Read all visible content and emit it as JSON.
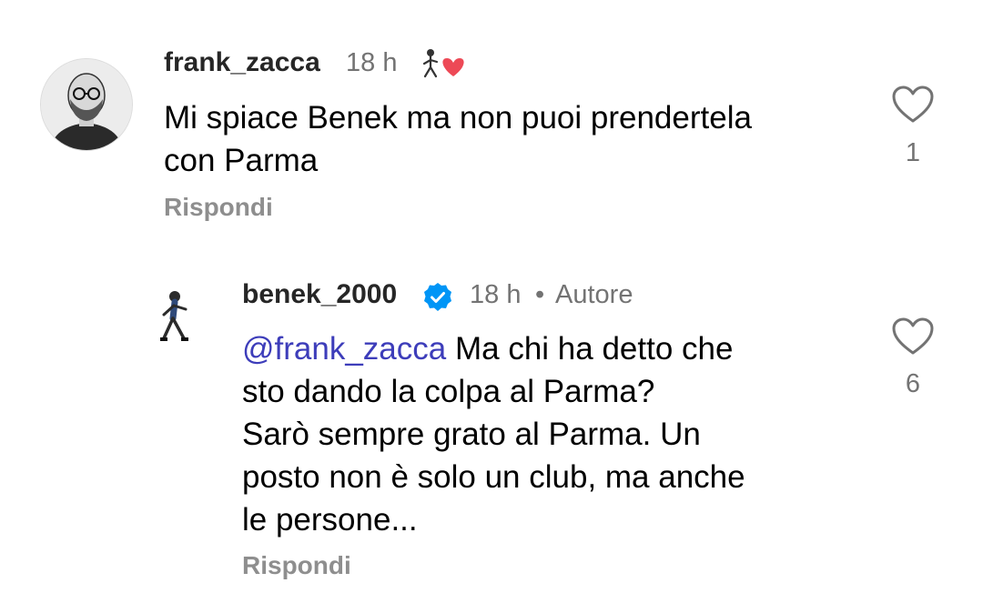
{
  "comments": [
    {
      "username": "frank_zacca",
      "time": "18 h",
      "text_lines": [
        "Mi spiace Benek ma non puoi prendertela",
        "con Parma"
      ],
      "reply_label": "Rispondi",
      "like_count": "1",
      "avatar_icon": "user-avatar-bald-glasses",
      "creator_like_icon": "liked-by-author-heart-icon"
    },
    {
      "username": "benek_2000",
      "verified_icon": "verified-badge-icon",
      "time": "18 h",
      "separator": "•",
      "author_label": "Autore",
      "mention": "@frank_zacca",
      "text_lines": [
        " Ma chi ha detto che",
        "sto dando la colpa al Parma?",
        "Sarò sempre grato al Parma. Un",
        "posto non è solo un club, ma anche",
        "le persone..."
      ],
      "reply_label": "Rispondi",
      "like_count": "6",
      "avatar_icon": "user-avatar-footballer"
    }
  ],
  "colors": {
    "verified": "#0095f6",
    "heart": "#ed4956",
    "mention": "#3d3dba",
    "muted": "#737373"
  }
}
